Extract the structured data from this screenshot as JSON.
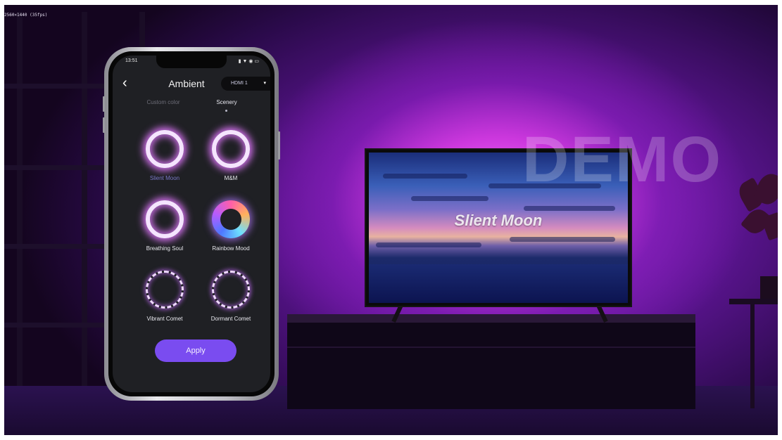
{
  "overlay": {
    "resolution_label": "2560×1440 (35fps)"
  },
  "tv": {
    "scene_title": "Slient Moon",
    "watermark": "DEMO"
  },
  "phone": {
    "status": {
      "time": "13:51",
      "icons": "▮ ▼ ◉ ▭"
    },
    "header": {
      "back": "‹",
      "title": "Ambient",
      "source": "HDMI 1",
      "source_caret": "▾"
    },
    "tabs": [
      {
        "label": "Custom color",
        "active": false
      },
      {
        "label": "Scenery",
        "active": true
      }
    ],
    "scenes": [
      {
        "label": "Slient Moon",
        "style": "ring",
        "selected": true
      },
      {
        "label": "M&M",
        "style": "ring",
        "selected": false
      },
      {
        "label": "Breathing Soul",
        "style": "ring",
        "selected": false
      },
      {
        "label": "Rainbow Mood",
        "style": "rainbow",
        "selected": false
      },
      {
        "label": "Vibrant Comet",
        "style": "comet",
        "selected": false
      },
      {
        "label": "Dormant Comet",
        "style": "comet",
        "selected": false
      }
    ],
    "apply_label": "Apply"
  },
  "colors": {
    "accent": "#7a4cf0",
    "glow": "#e27cff",
    "screen_bg": "#1f2024"
  }
}
